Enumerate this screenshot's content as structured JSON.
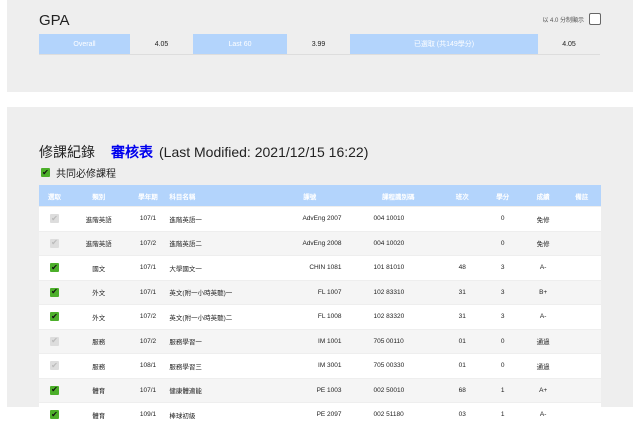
{
  "gpa": {
    "title": "GPA",
    "scale_label": "以 4.0 分制顯示",
    "items": [
      {
        "label": "Overall",
        "value": "4.05"
      },
      {
        "label": "Last 60",
        "value": "3.99"
      },
      {
        "label": "已選取 (共149學分)",
        "value": "4.05"
      }
    ]
  },
  "records": {
    "title": "修課紀錄",
    "link": "審核表",
    "modified": "(Last Modified: 2021/12/15 16:22)",
    "common_label": "共同必修課程",
    "columns": [
      "選取",
      "類別",
      "學年期",
      "科目名稱",
      "課號",
      "課程識別碼",
      "班次",
      "學分",
      "成績",
      "備註"
    ],
    "rows": [
      {
        "checked": false,
        "cells": [
          "進階英語",
          "107/1",
          "進階英語一",
          "AdvEng 2007",
          "004 10010",
          "",
          "0",
          "免修",
          ""
        ]
      },
      {
        "checked": false,
        "cells": [
          "進階英語",
          "107/2",
          "進階英語二",
          "AdvEng 2008",
          "004 10020",
          "",
          "0",
          "免修",
          ""
        ]
      },
      {
        "checked": true,
        "cells": [
          "國文",
          "107/1",
          "大學國文一",
          "CHIN 1081",
          "101 81010",
          "48",
          "3",
          "A-",
          ""
        ]
      },
      {
        "checked": true,
        "cells": [
          "外文",
          "107/1",
          "英文(附一小時英聽)一",
          "FL 1007",
          "102 83310",
          "31",
          "3",
          "B+",
          ""
        ]
      },
      {
        "checked": true,
        "cells": [
          "外文",
          "107/2",
          "英文(附一小時英聽)二",
          "FL 1008",
          "102 83320",
          "31",
          "3",
          "A-",
          ""
        ]
      },
      {
        "checked": false,
        "cells": [
          "服務",
          "107/2",
          "服務學習一",
          "IM 1001",
          "705 00110",
          "01",
          "0",
          "通過",
          ""
        ]
      },
      {
        "checked": false,
        "cells": [
          "服務",
          "108/1",
          "服務學習三",
          "IM 3001",
          "705 00330",
          "01",
          "0",
          "通過",
          ""
        ]
      },
      {
        "checked": true,
        "cells": [
          "體育",
          "107/1",
          "健康體適能",
          "PE 1003",
          "002 50010",
          "68",
          "1",
          "A+",
          ""
        ]
      },
      {
        "checked": true,
        "cells": [
          "體育",
          "109/1",
          "棒球初級",
          "PE 2097",
          "002 51180",
          "03",
          "1",
          "A-",
          ""
        ]
      }
    ]
  }
}
